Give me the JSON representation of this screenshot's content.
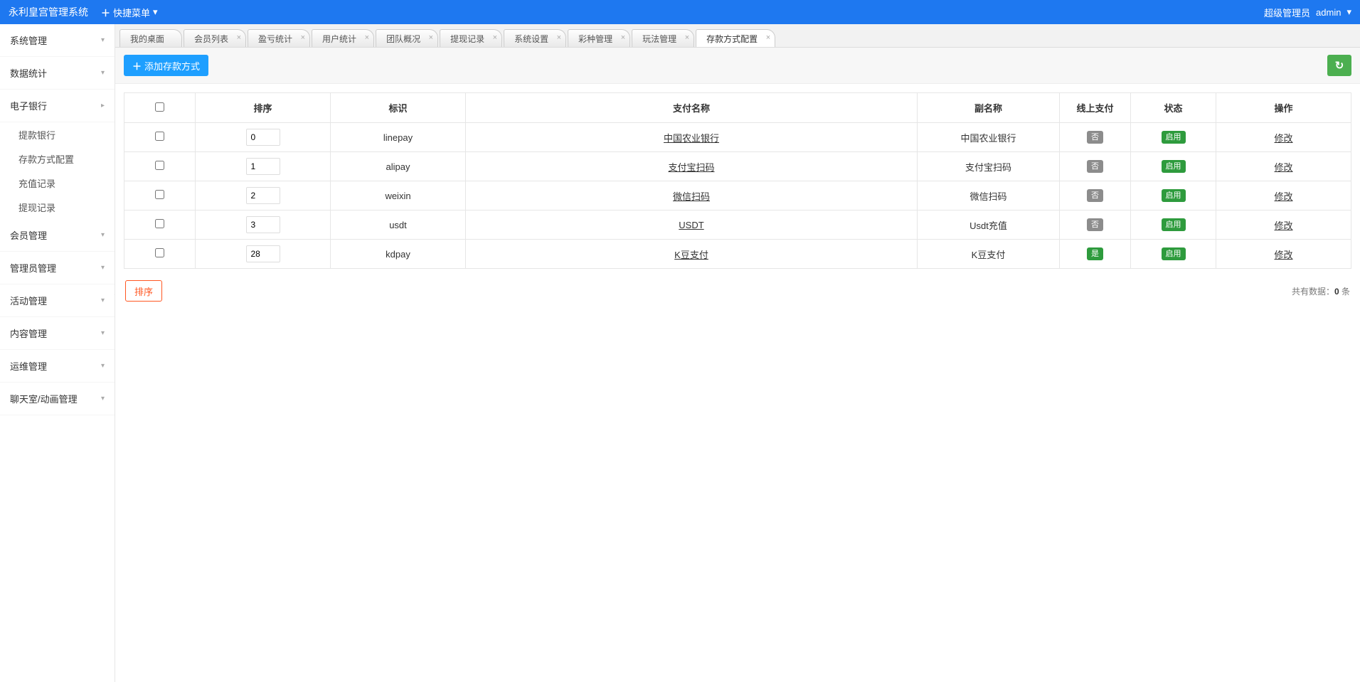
{
  "header": {
    "logo": "永利皇宫管理系统",
    "quick_menu": "快捷菜单",
    "user_role": "超级管理员",
    "user_name": "admin"
  },
  "sidebar": {
    "items": [
      {
        "label": "系统管理",
        "expanded": false
      },
      {
        "label": "数据统计",
        "expanded": false
      },
      {
        "label": "电子银行",
        "expanded": true,
        "children": [
          {
            "label": "提款银行"
          },
          {
            "label": "存款方式配置"
          },
          {
            "label": "充值记录"
          },
          {
            "label": "提现记录"
          }
        ]
      },
      {
        "label": "会员管理",
        "expanded": false
      },
      {
        "label": "管理员管理",
        "expanded": false
      },
      {
        "label": "活动管理",
        "expanded": false
      },
      {
        "label": "内容管理",
        "expanded": false
      },
      {
        "label": "运维管理",
        "expanded": false
      },
      {
        "label": "聊天室/动画管理",
        "expanded": false
      }
    ]
  },
  "tabs": [
    {
      "label": "我的桌面",
      "closable": false
    },
    {
      "label": "会员列表",
      "closable": true
    },
    {
      "label": "盈亏统计",
      "closable": true
    },
    {
      "label": "用户统计",
      "closable": true
    },
    {
      "label": "团队概况",
      "closable": true
    },
    {
      "label": "提现记录",
      "closable": true
    },
    {
      "label": "系统设置",
      "closable": true
    },
    {
      "label": "彩种管理",
      "closable": true
    },
    {
      "label": "玩法管理",
      "closable": true
    },
    {
      "label": "存款方式配置",
      "closable": true,
      "active": true
    }
  ],
  "toolbar": {
    "add_label": "添加存款方式"
  },
  "table": {
    "headers": {
      "checkbox": "",
      "sort": "排序",
      "identifier": "标识",
      "pay_name": "支付名称",
      "sub_name": "副名称",
      "online_pay": "线上支付",
      "status": "状态",
      "action": "操作"
    },
    "rows": [
      {
        "sort": "0",
        "identifier": "linepay",
        "pay_name": "中国农业银行",
        "sub_name": "中国农业银行",
        "online_pay": "否",
        "status": "启用",
        "action": "修改"
      },
      {
        "sort": "1",
        "identifier": "alipay",
        "pay_name": "支付宝扫码",
        "sub_name": "支付宝扫码",
        "online_pay": "否",
        "status": "启用",
        "action": "修改"
      },
      {
        "sort": "2",
        "identifier": "weixin",
        "pay_name": "微信扫码",
        "sub_name": "微信扫码",
        "online_pay": "否",
        "status": "启用",
        "action": "修改"
      },
      {
        "sort": "3",
        "identifier": "usdt",
        "pay_name": "USDT",
        "sub_name": "Usdt充值",
        "online_pay": "否",
        "status": "启用",
        "action": "修改"
      },
      {
        "sort": "28",
        "identifier": "kdpay",
        "pay_name": "K豆支付",
        "sub_name": "K豆支付",
        "online_pay": "是",
        "status": "启用",
        "action": "修改"
      }
    ]
  },
  "footer": {
    "sort_button": "排序",
    "total_prefix": "共有数据：",
    "total_count": "0",
    "total_suffix": " 条"
  },
  "badge_online_yes": "是",
  "badge_online_no": "否"
}
